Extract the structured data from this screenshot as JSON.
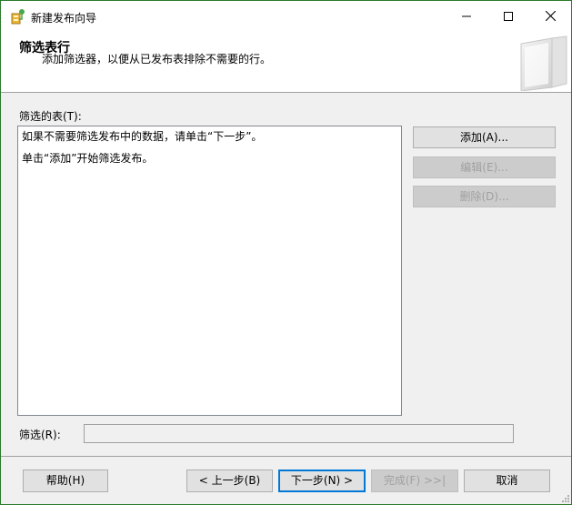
{
  "window": {
    "title": "新建发布向导",
    "controls": {
      "minimize": "minimize-icon",
      "maximize": "maximize-icon",
      "close": "close-icon"
    }
  },
  "header": {
    "title": "筛选表行",
    "subtitle": "添加筛选器，以便从已发布表排除不需要的行。"
  },
  "main": {
    "tables_label": "筛选的表(T):",
    "list_lines": [
      "如果不需要筛选发布中的数据，请单击“下一步”。",
      "单击“添加”开始筛选发布。"
    ],
    "buttons": {
      "add": "添加(A)...",
      "edit": "编辑(E)...",
      "delete": "删除(D)..."
    },
    "filter_label": "筛选(R):",
    "filter_value": ""
  },
  "footer": {
    "help": "帮助(H)",
    "back": "< 上一步(B)",
    "next": "下一步(N) >",
    "finish": "完成(F) >>|",
    "cancel": "取消"
  },
  "colors": {
    "accent": "#0078d7",
    "window_border": "#2b7a2b",
    "disabled_text": "#a0a0a0"
  }
}
